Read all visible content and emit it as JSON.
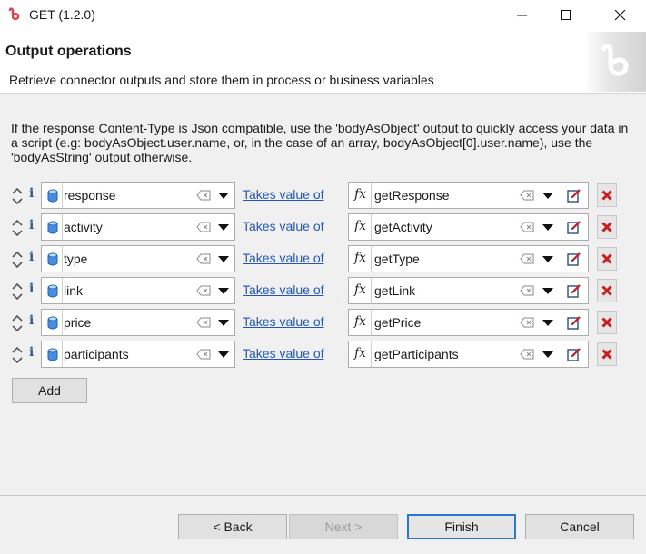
{
  "window": {
    "title": "GET (1.2.0)",
    "accent": "#e0404a"
  },
  "header": {
    "title": "Output operations",
    "subtitle": "Retrieve connector outputs and store them in process or business variables"
  },
  "description": "If the response Content-Type is Json compatible, use the 'bodyAsObject' output to quickly access your data in a script (e.g: bodyAsObject.user.name, or, in the case of an array, bodyAsObject[0].user.name), use the 'bodyAsString' output otherwise.",
  "operations": [
    {
      "variable": "response",
      "link": "Takes value of",
      "expression": "getResponse"
    },
    {
      "variable": "activity",
      "link": "Takes value of",
      "expression": "getActivity"
    },
    {
      "variable": "type",
      "link": "Takes value of",
      "expression": "getType"
    },
    {
      "variable": "link",
      "link": "Takes value of",
      "expression": "getLink"
    },
    {
      "variable": "price",
      "link": "Takes value of",
      "expression": "getPrice"
    },
    {
      "variable": "participants",
      "link": "Takes value of",
      "expression": "getParticipants"
    }
  ],
  "icons": {
    "move": "up-down-arrows-icon",
    "info": "info-icon",
    "variable_type": "variable-cylinder-icon",
    "clear": "clear-text-icon",
    "expression": "fx-icon",
    "edit": "edit-expression-icon",
    "delete": "delete-red-x-icon"
  },
  "buttons": {
    "add": "Add",
    "back": "< Back",
    "next": "Next >",
    "finish": "Finish",
    "cancel": "Cancel"
  },
  "colors": {
    "link": "#1f57c2",
    "delete": "#d11a1a",
    "default_button_border": "#2b78d4"
  }
}
